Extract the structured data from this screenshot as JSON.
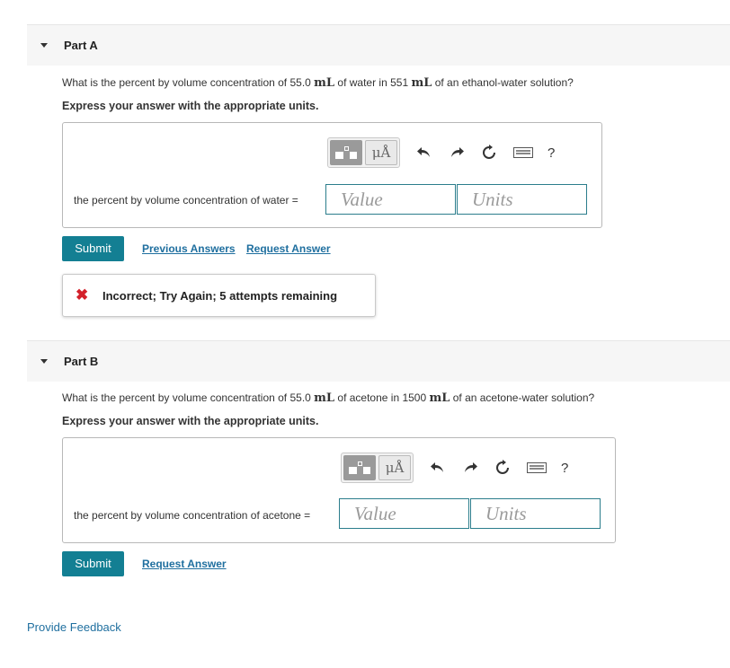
{
  "partA": {
    "title": "Part A",
    "question_pre": "What is the percent by volume concentration of 55.0 ",
    "unit1": "mL",
    "question_mid": " of water in 551 ",
    "unit2": "mL",
    "question_post": " of an ethanol-water solution?",
    "instruction": "Express your answer with the appropriate units.",
    "toolbar": {
      "units_btn": "μÅ",
      "help": "?"
    },
    "label": "the percent by volume concentration of water =",
    "value_placeholder": "Value",
    "units_placeholder": "Units",
    "submit": "Submit",
    "previous_answers": "Previous Answers",
    "request_answer": "Request Answer",
    "feedback": "Incorrect; Try Again; 5 attempts remaining",
    "feedback_icon": "✖"
  },
  "partB": {
    "title": "Part B",
    "question_pre": "What is the percent by volume concentration of 55.0 ",
    "unit1": "mL",
    "question_mid": " of acetone in 1500 ",
    "unit2": "mL",
    "question_post": " of an acetone-water solution?",
    "instruction": "Express your answer with the appropriate units.",
    "toolbar": {
      "units_btn": "μÅ",
      "help": "?"
    },
    "label": "the percent by volume concentration of acetone =",
    "value_placeholder": "Value",
    "units_placeholder": "Units",
    "submit": "Submit",
    "request_answer": "Request Answer"
  },
  "footer": {
    "provide_feedback": "Provide Feedback"
  },
  "colors": {
    "accent": "#137f93",
    "link": "#1f6f9f",
    "error": "#d3202a",
    "field_border": "#2b7d8c"
  }
}
